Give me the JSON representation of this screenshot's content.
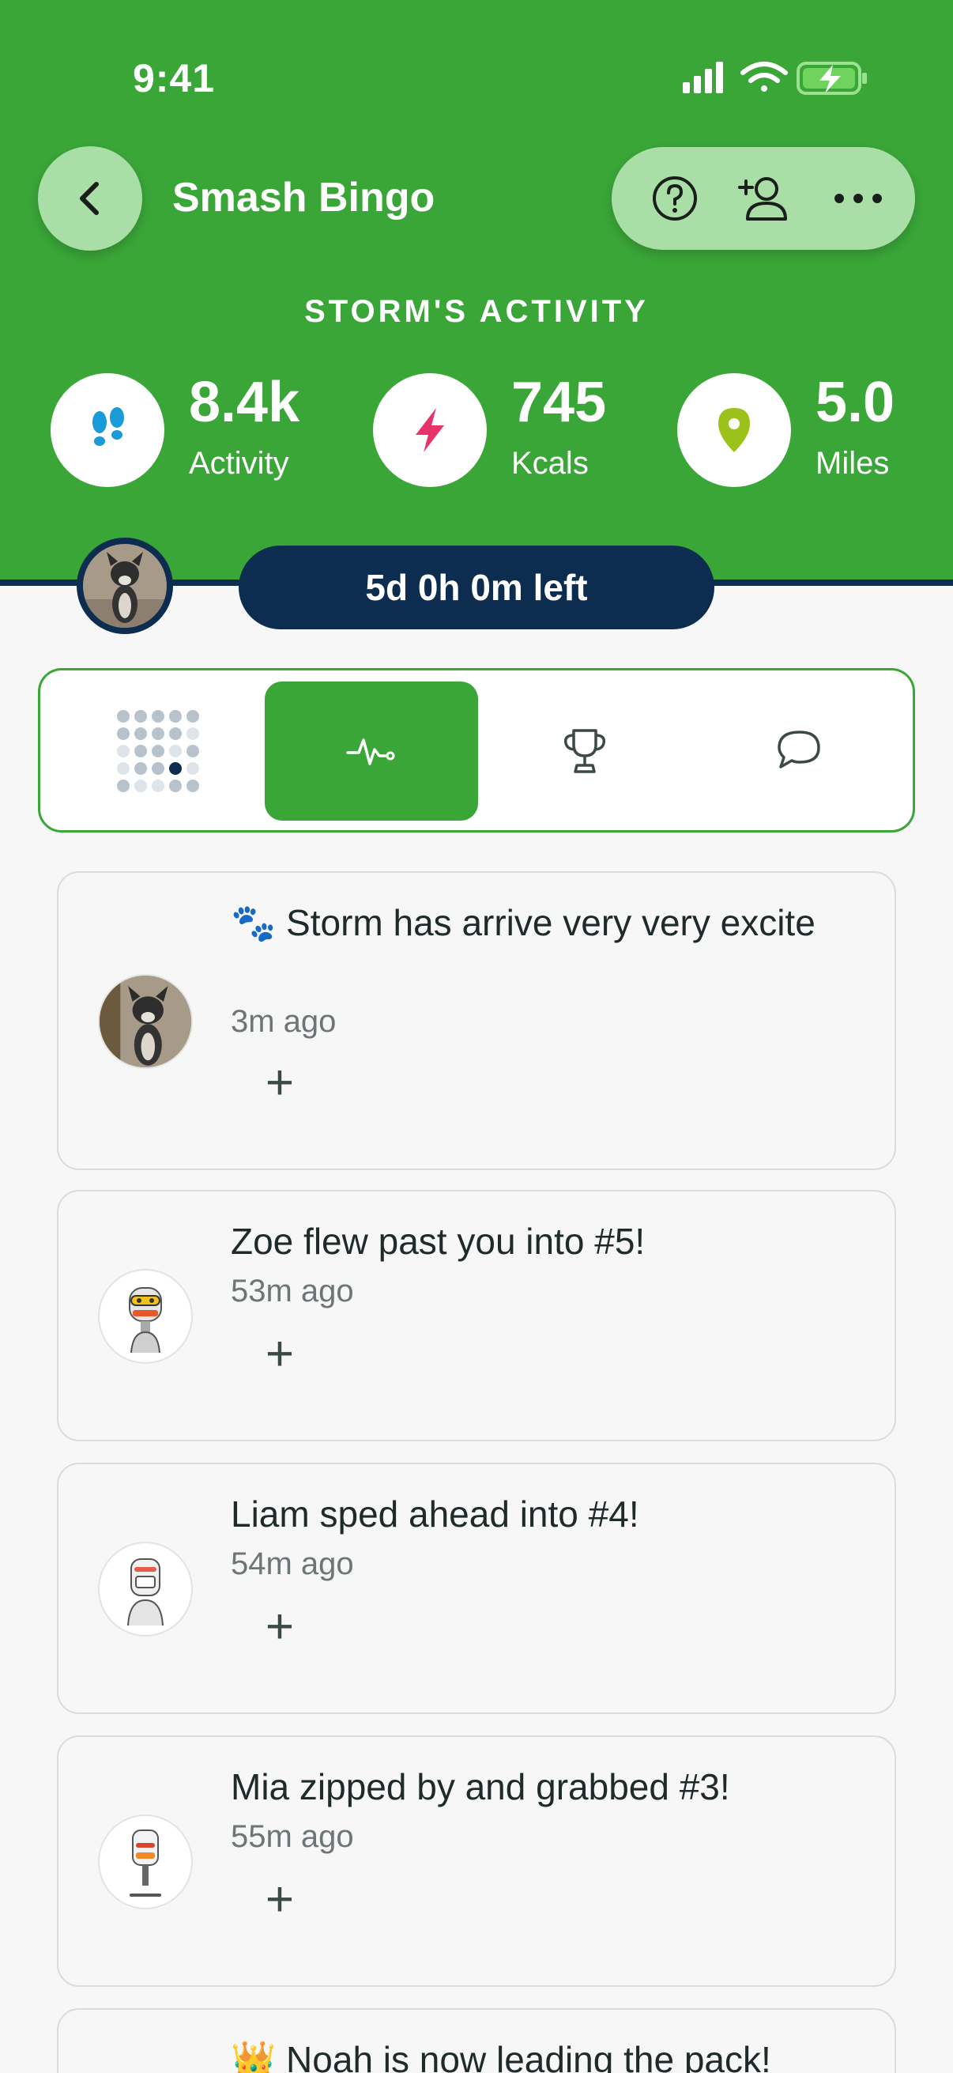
{
  "status_bar": {
    "time": "9:41"
  },
  "header": {
    "title": "Smash Bingo",
    "back_icon": "chevron-left-icon",
    "actions": [
      "help-icon",
      "add-person-icon",
      "more-icon"
    ]
  },
  "activity": {
    "title": "STORM'S ACTIVITY",
    "stats": [
      {
        "value": "8.4k",
        "label": "Activity",
        "icon": "footsteps-icon",
        "color": "#1a9ad6"
      },
      {
        "value": "745",
        "label": "Kcals",
        "icon": "lightning-icon",
        "color": "#e8336a"
      },
      {
        "value": "5.0",
        "label": "Miles",
        "icon": "location-pin-icon",
        "color": "#9bc21a"
      }
    ]
  },
  "timer": {
    "text": "5d 0h 0m left"
  },
  "tabs": [
    {
      "name": "bingo-board",
      "icon": "grid-icon",
      "active": false
    },
    {
      "name": "activity",
      "icon": "pulse-icon",
      "active": true
    },
    {
      "name": "leaderboard",
      "icon": "trophy-icon",
      "active": false
    },
    {
      "name": "chat",
      "icon": "chat-icon",
      "active": false
    }
  ],
  "feed": [
    {
      "message": "🐾 Storm has arrive very very excite",
      "time": "3m ago",
      "add": "+"
    },
    {
      "message": "Zoe flew past you into #5!",
      "time": "53m ago",
      "add": "+"
    },
    {
      "message": "Liam sped ahead into #4!",
      "time": "54m ago",
      "add": "+"
    },
    {
      "message": "Mia zipped by and grabbed #3!",
      "time": "55m ago",
      "add": "+"
    },
    {
      "message": "👑 Noah is now leading the pack!",
      "time": "",
      "add": ""
    }
  ],
  "colors": {
    "brand_green": "#3aa638",
    "navy": "#0c2d4f",
    "light_green": "#a9dfa6"
  }
}
